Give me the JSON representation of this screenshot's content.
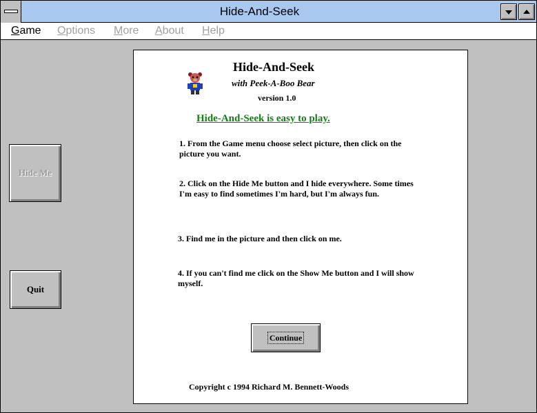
{
  "window": {
    "title": "Hide-And-Seek"
  },
  "menu": [
    {
      "label": "Game",
      "accel": "G",
      "rest": "ame",
      "enabled": true
    },
    {
      "label": "Options",
      "accel": "O",
      "rest": "ptions",
      "enabled": false
    },
    {
      "label": "More",
      "accel": "M",
      "rest": "ore",
      "enabled": false
    },
    {
      "label": "About",
      "accel": "A",
      "rest": "bout",
      "enabled": false
    },
    {
      "label": "Help",
      "accel": "H",
      "rest": "elp",
      "enabled": false
    }
  ],
  "buttons": {
    "hide_me": "Hide Me",
    "quit": "Quit",
    "continue": "Continue"
  },
  "panel": {
    "title": "Hide-And-Seek",
    "subtitle": "with Peek-A-Boo Bear",
    "version": "version 1.0",
    "headline": "Hide-And-Seek is easy to play.",
    "steps": [
      "1. From the Game menu choose select picture, then click on the picture you want.",
      "2. Click on the Hide Me button and I hide everywhere. Some times I'm easy to find sometimes I'm hard, but I'm always fun.",
      "3. Find me in the picture and then click on me.",
      "4. If you can't find me click on the Show Me button and I will show myself."
    ],
    "copyright": "Copyright c 1994 Richard M. Bennett-Woods"
  },
  "icons": {
    "bear": "bear-icon"
  }
}
